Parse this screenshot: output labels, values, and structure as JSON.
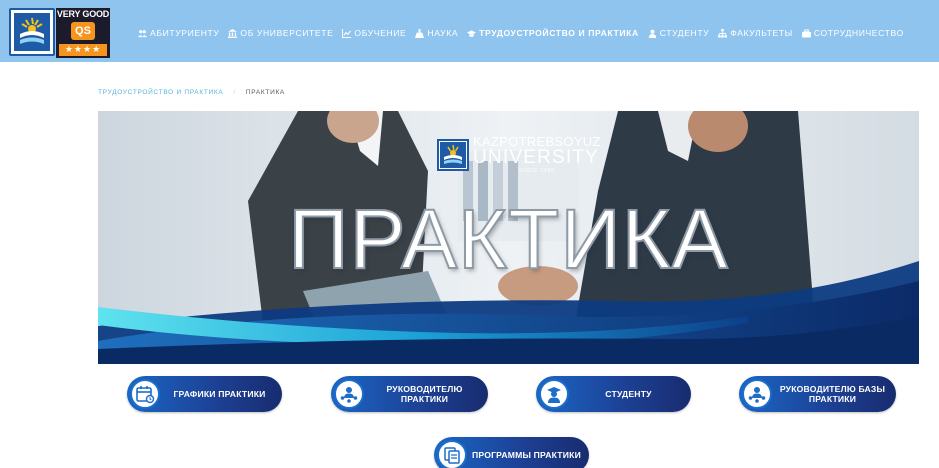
{
  "header": {
    "qs_badge": {
      "top_text": "VERY GOOD",
      "logo_text": "QS",
      "stars": "★★★★"
    },
    "nav": [
      {
        "label": "АБИТУРИЕНТУ",
        "icon": "users-icon"
      },
      {
        "label": "ОБ УНИВЕРСИТЕТЕ",
        "icon": "university-icon"
      },
      {
        "label": "ОБУЧЕНИЕ",
        "icon": "chart-icon"
      },
      {
        "label": "НАУКА",
        "icon": "flask-icon"
      },
      {
        "label": "ТРУДОУСТРОЙСТВО И ПРАКТИКА",
        "icon": "graduation-cap-icon",
        "active": true
      },
      {
        "label": "СТУДЕНТУ",
        "icon": "student-icon"
      },
      {
        "label": "ФАКУЛЬТЕТЫ",
        "icon": "sitemap-icon"
      },
      {
        "label": "СОТРУДНИЧЕСТВО",
        "icon": "briefcase-icon"
      }
    ],
    "colors": {
      "bar": "#8fc4ef",
      "text": "#ffffff"
    }
  },
  "breadcrumb": {
    "parent": "ТРУДОУСТРОЙСТВО И ПРАКТИКА",
    "separator": "/",
    "current": "ПРАКТИКА"
  },
  "banner": {
    "brand_top": "KAZPOTREBSOYUZ",
    "brand_main": "UNIVERSITY",
    "brand_since": "SINCE 1966",
    "title": "ПРАКТИКА"
  },
  "buttons": [
    {
      "label": "ГРАФИКИ ПРАКТИКИ",
      "icon": "calendar-icon"
    },
    {
      "label": "РУКОВОДИТЕЛЮ ПРАКТИКИ",
      "icon": "team-icon"
    },
    {
      "label": "СТУДЕНТУ",
      "icon": "student-icon"
    },
    {
      "label": "РУКОВОДИТЕЛЮ БАЗЫ ПРАКТИКИ",
      "icon": "team-icon"
    },
    {
      "label": "ПРОГРАММЫ ПРАКТИКИ",
      "icon": "documents-icon"
    }
  ],
  "colors": {
    "accent": "#58b3d8",
    "button": "#1d3f92",
    "button_light": "#1a67c6"
  }
}
